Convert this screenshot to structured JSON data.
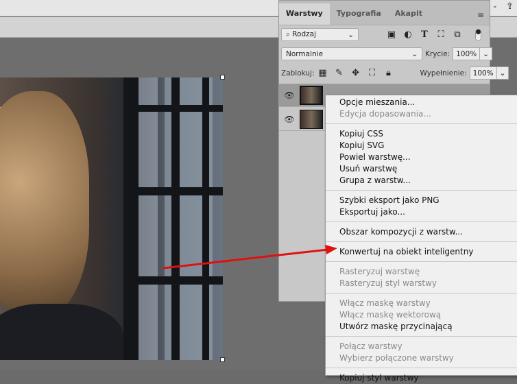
{
  "panel": {
    "tabs": [
      "Warstwy",
      "Typografia",
      "Akapit"
    ],
    "filter": "Rodzaj",
    "blend_mode": "Normalnie",
    "opacity_label": "Krycie:",
    "opacity": "100%",
    "lock_label": "Zablokuj:",
    "fill_label": "Wypełnienie:",
    "fill": "100%"
  },
  "menu": {
    "groups": [
      [
        {
          "label": "Opcje mieszania...",
          "enabled": true
        },
        {
          "label": "Edycja dopasowania...",
          "enabled": false
        }
      ],
      [
        {
          "label": "Kopiuj CSS",
          "enabled": true
        },
        {
          "label": "Kopiuj SVG",
          "enabled": true
        },
        {
          "label": "Powiel warstwę...",
          "enabled": true
        },
        {
          "label": "Usuń warstwę",
          "enabled": true
        },
        {
          "label": "Grupa z warstw...",
          "enabled": true
        }
      ],
      [
        {
          "label": "Szybki eksport jako PNG",
          "enabled": true
        },
        {
          "label": "Eksportuj jako...",
          "enabled": true
        }
      ],
      [
        {
          "label": "Obszar kompozycji z warstw...",
          "enabled": true
        }
      ],
      [
        {
          "label": "Konwertuj na obiekt inteligentny",
          "enabled": true
        }
      ],
      [
        {
          "label": "Rasteryzuj warstwę",
          "enabled": false
        },
        {
          "label": "Rasteryzuj styl warstwy",
          "enabled": false
        }
      ],
      [
        {
          "label": "Włącz maskę warstwy",
          "enabled": false
        },
        {
          "label": "Włącz maskę wektorową",
          "enabled": false
        },
        {
          "label": "Utwórz maskę przycinającą",
          "enabled": true
        }
      ],
      [
        {
          "label": "Połącz warstwy",
          "enabled": false
        },
        {
          "label": "Wybierz połączone warstwy",
          "enabled": false
        }
      ],
      [
        {
          "label": "Kopiuj styl warstwy",
          "enabled": true
        }
      ]
    ]
  },
  "colors": {
    "arrow": "#e01010"
  }
}
